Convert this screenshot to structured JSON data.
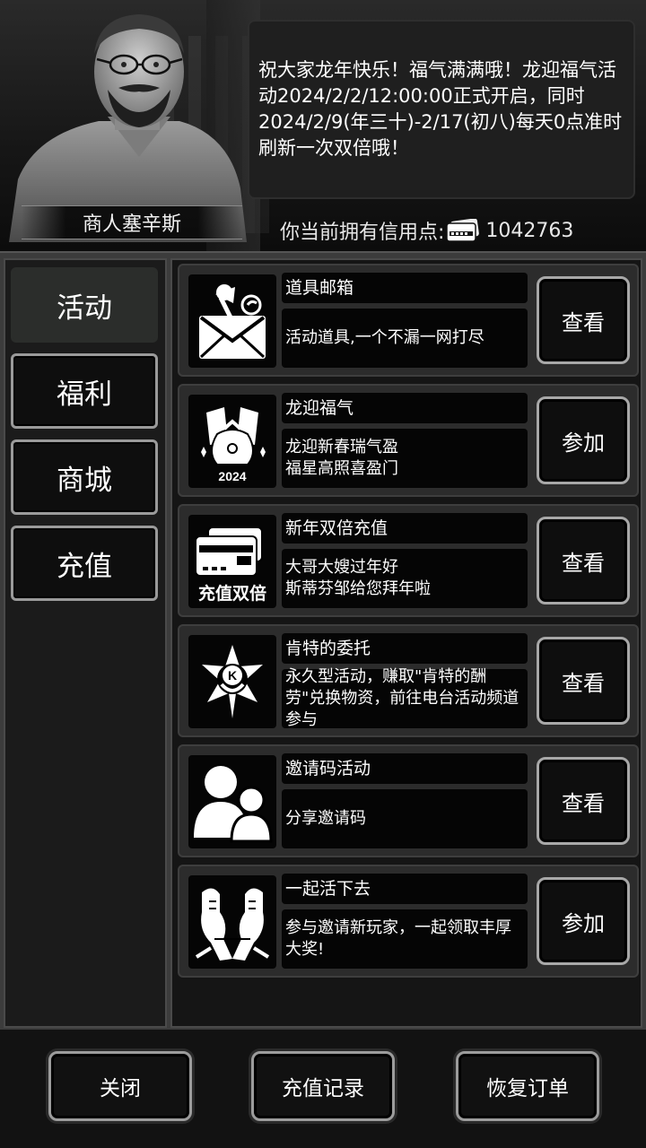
{
  "npc": {
    "name": "商人塞辛斯",
    "message": "祝大家龙年快乐！福气满满哦！龙迎福气活动2024/2/2/12:00:00正式开启，同时2024/2/9(年三十)-2/17(初八)每天0点准时刷新一次双倍哦！"
  },
  "credit": {
    "label": "你当前拥有信用点:",
    "value": "1042763"
  },
  "sidebar": {
    "tabs": [
      {
        "label": "活动",
        "active": true
      },
      {
        "label": "福利",
        "active": false
      },
      {
        "label": "商城",
        "active": false
      },
      {
        "label": "充值",
        "active": false
      }
    ]
  },
  "activities": [
    {
      "icon": "mail-pin-icon",
      "title": "道具邮箱",
      "desc": "活动道具,一个不漏一网打尽",
      "action": "查看"
    },
    {
      "icon": "lucky-bag-2024-icon",
      "title": "龙迎福气",
      "desc": "龙迎新春瑞气盈\n福星高照喜盈门",
      "action": "参加",
      "icon_text": "2024"
    },
    {
      "icon": "double-recharge-card-icon",
      "title": "新年双倍充值",
      "desc": "大哥大嫂过年好\n斯蒂芬邹给您拜年啦",
      "action": "查看",
      "icon_text": "充值双倍"
    },
    {
      "icon": "kent-emblem-icon",
      "title": "肯特的委托",
      "desc": "永久型活动，赚取\"肯特的酬劳\"兑换物资，前往电台活动频道参与",
      "action": "查看",
      "icon_text": "K"
    },
    {
      "icon": "users-icon",
      "title": "邀请码活动",
      "desc": "分享邀请码",
      "action": "查看"
    },
    {
      "icon": "thumbs-up-hands-icon",
      "title": "一起活下去",
      "desc": "参与邀请新玩家，一起领取丰厚大奖!",
      "action": "参加"
    }
  ],
  "footer": {
    "close": "关闭",
    "recharge_record": "充值记录",
    "restore_order": "恢复订单"
  },
  "colors": {
    "panel": "#3c3c3c",
    "card": "#2c2c2c",
    "box": "#050505",
    "button_border": "#a8a8a8"
  }
}
